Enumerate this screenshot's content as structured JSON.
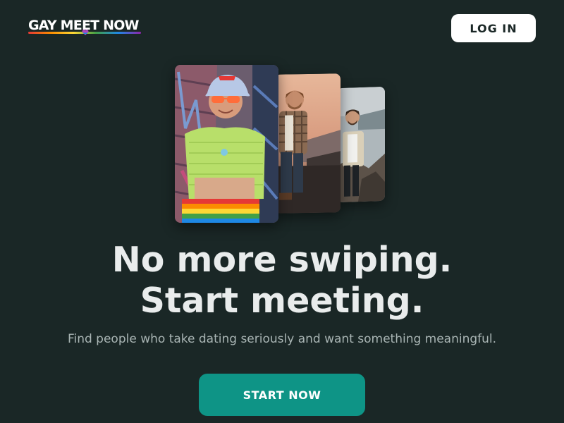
{
  "header": {
    "logo_text": "GAY MEET NOW",
    "login_label": "LOG IN"
  },
  "hero": {
    "photos": [
      {
        "icon": "profile-photo-rainbow-hat-man"
      },
      {
        "icon": "profile-photo-plaid-shirt-man"
      },
      {
        "icon": "profile-photo-seaside-man"
      }
    ],
    "headline_line1": "No more swiping.",
    "headline_line2": "Start meeting.",
    "subtext": "Find people who take dating seriously and want something meaningful.",
    "cta_label": "START NOW"
  },
  "colors": {
    "background": "#1a2726",
    "accent": "#0e9486",
    "text": "#e9ecec",
    "subtext": "#a9b5b4"
  }
}
